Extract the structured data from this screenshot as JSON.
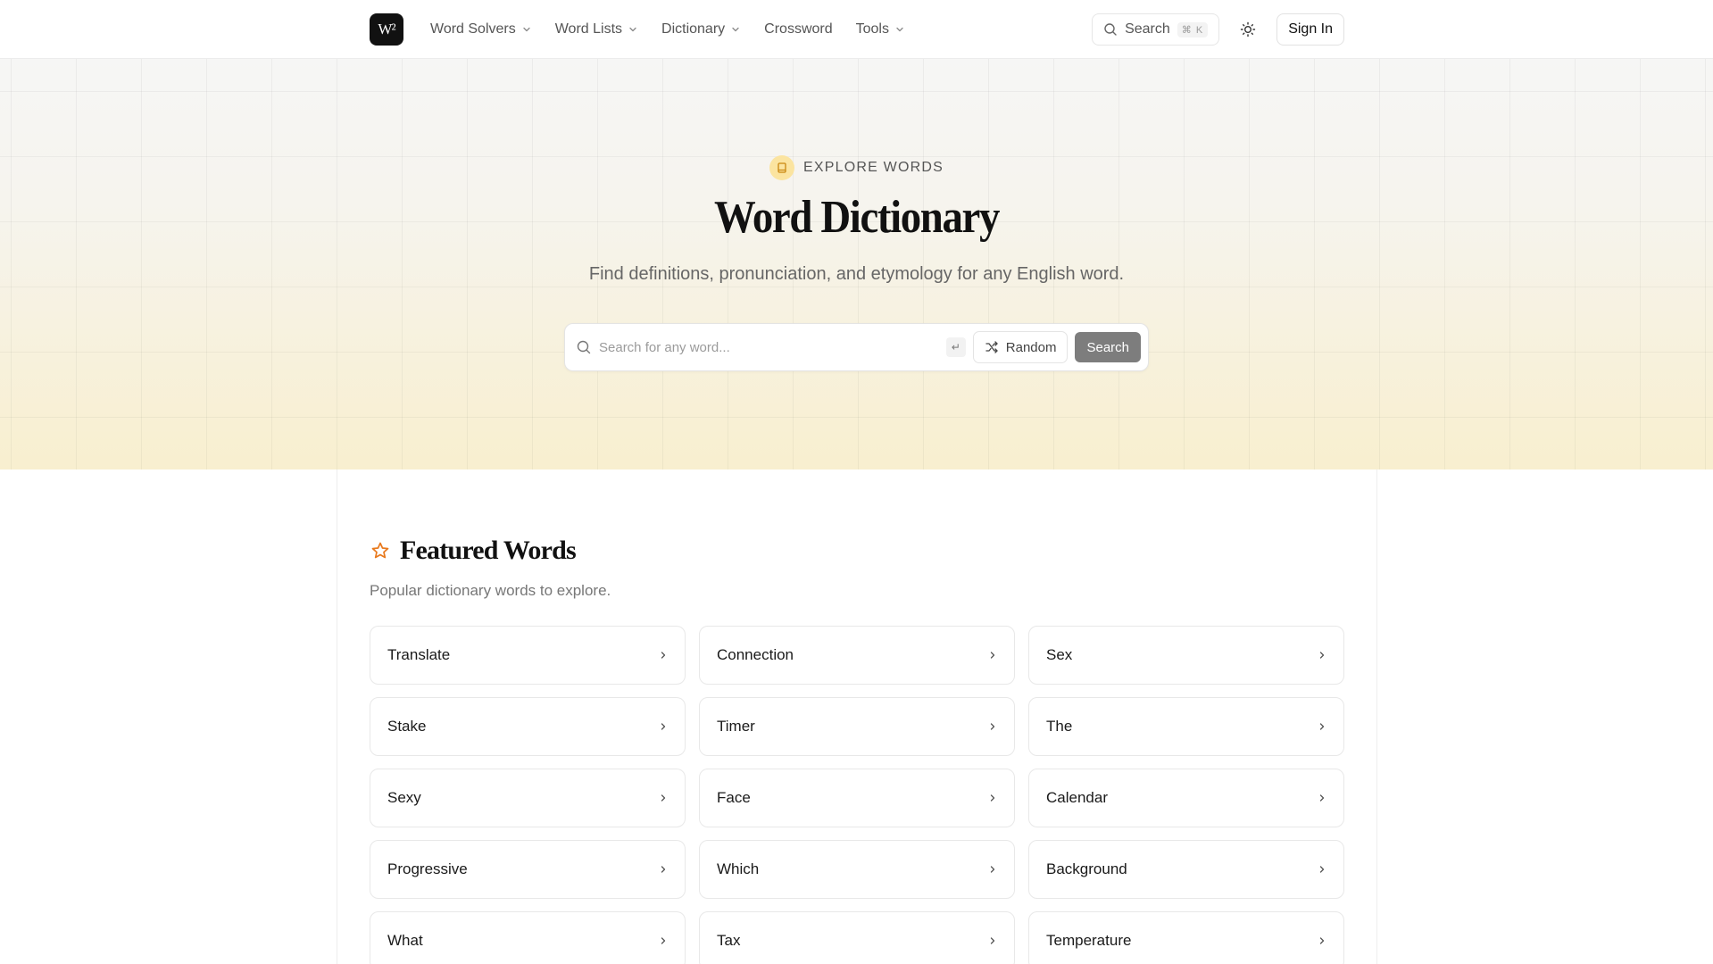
{
  "header": {
    "logo_text": "W²",
    "nav": [
      {
        "label": "Word Solvers",
        "dropdown": true
      },
      {
        "label": "Word Lists",
        "dropdown": true
      },
      {
        "label": "Dictionary",
        "dropdown": true
      },
      {
        "label": "Crossword",
        "dropdown": false
      },
      {
        "label": "Tools",
        "dropdown": true
      }
    ],
    "search_label": "Search",
    "search_shortcut": "⌘ K",
    "theme_icon": "sun-icon",
    "signin_label": "Sign In"
  },
  "hero": {
    "eyebrow": "EXPLORE WORDS",
    "eyebrow_icon": "book-icon",
    "title": "Word Dictionary",
    "subtitle": "Find definitions, pronunciation, and etymology for any English word.",
    "search_placeholder": "Search for any word...",
    "enter_key": "↵",
    "random_label": "Random",
    "search_button": "Search"
  },
  "featured": {
    "title": "Featured Words",
    "subtitle": "Popular dictionary words to explore.",
    "words": [
      "Translate",
      "Connection",
      "Sex",
      "Stake",
      "Timer",
      "The",
      "Sexy",
      "Face",
      "Calendar",
      "Progressive",
      "Which",
      "Background",
      "What",
      "Tax",
      "Temperature"
    ]
  },
  "colors": {
    "accent_orange": "#e8791d",
    "eyebrow_icon_bg": "#fbe4a0",
    "search_button_bg": "#7d7d7d",
    "logo_bg": "#111111"
  }
}
